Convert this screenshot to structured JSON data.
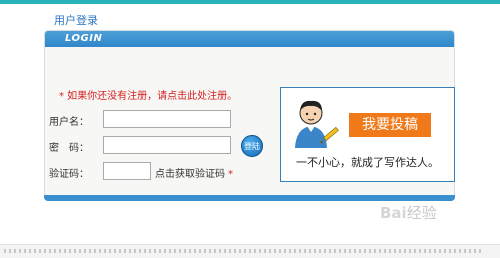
{
  "page": {
    "title": "用户登录"
  },
  "panel": {
    "header": "LOGIN"
  },
  "form": {
    "notice": "* 如果你还没有注册，请点击此处注册。",
    "username_label": "用户名：",
    "password_label": "密　码：",
    "captcha_label": "验证码：",
    "captcha_link": "点击获取验证码",
    "captcha_star": "*",
    "username_value": "",
    "password_value": "",
    "captcha_value": "",
    "login_button": "登陆"
  },
  "promo": {
    "badge": "我要投稿",
    "slogan": "一不小心，就成了写作达人。"
  },
  "watermark": {
    "brand": "Bai",
    "suffix": "经验"
  },
  "colors": {
    "accent": "#2f86c9",
    "notice": "#d42020",
    "badge": "#f07a1a"
  }
}
